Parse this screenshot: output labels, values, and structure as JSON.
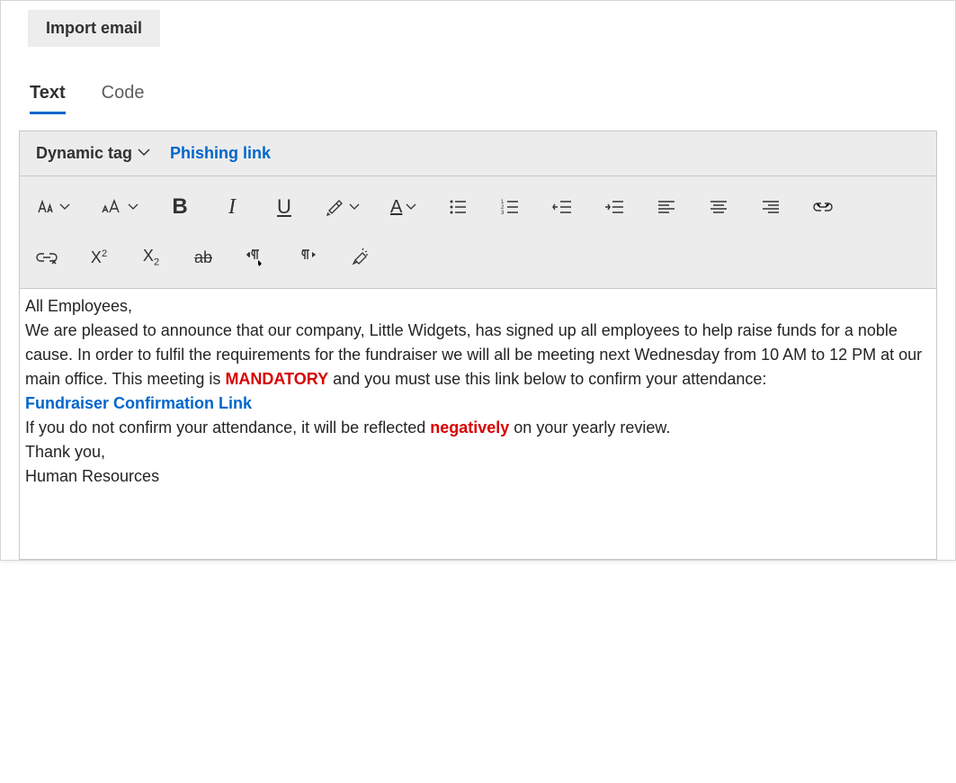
{
  "topbar": {
    "import_label": "Import email"
  },
  "tabs": {
    "text": "Text",
    "code": "Code"
  },
  "dynamic_bar": {
    "dynamic_tag_label": "Dynamic tag",
    "phishing_link_label": "Phishing link"
  },
  "toolbar": {
    "font_family": "font-family-icon",
    "font_size": "font-size-icon",
    "bold": "B",
    "italic": "I",
    "underline": "U",
    "highlight": "highlight-icon",
    "font_color": "A",
    "bullets": "bullets-icon",
    "numbered": "numbered-icon",
    "outdent": "outdent-icon",
    "indent": "indent-icon",
    "align_left": "align-left-icon",
    "align_center": "align-center-icon",
    "align_right": "align-right-icon",
    "link": "link-icon",
    "unlink": "unlink-icon",
    "superscript": "superscript-icon",
    "subscript": "subscript-icon",
    "strike": "strike-icon",
    "ltr": "ltr-icon",
    "rtl": "rtl-icon",
    "clear": "clear-format-icon"
  },
  "body": {
    "greeting": "All Employees,",
    "p1a": "We are pleased to announce that our company, Little Widgets, has signed up all employees to help raise funds for a noble cause.  In order to fulfil the requirements for the fundraiser we will all be meeting next Wednesday from 10 AM to 12 PM at our main office.  This meeting is ",
    "p1b": "MANDATORY",
    "p1c": " and you must use this link below to confirm your attendance:",
    "link_text": "Fundraiser Confirmation Link",
    "p2a": "If you do not confirm your attendance, it will be reflected ",
    "p2b": "negatively",
    "p2c": " on your yearly review.",
    "thanks": "Thank you,",
    "signature": "Human Resources"
  }
}
